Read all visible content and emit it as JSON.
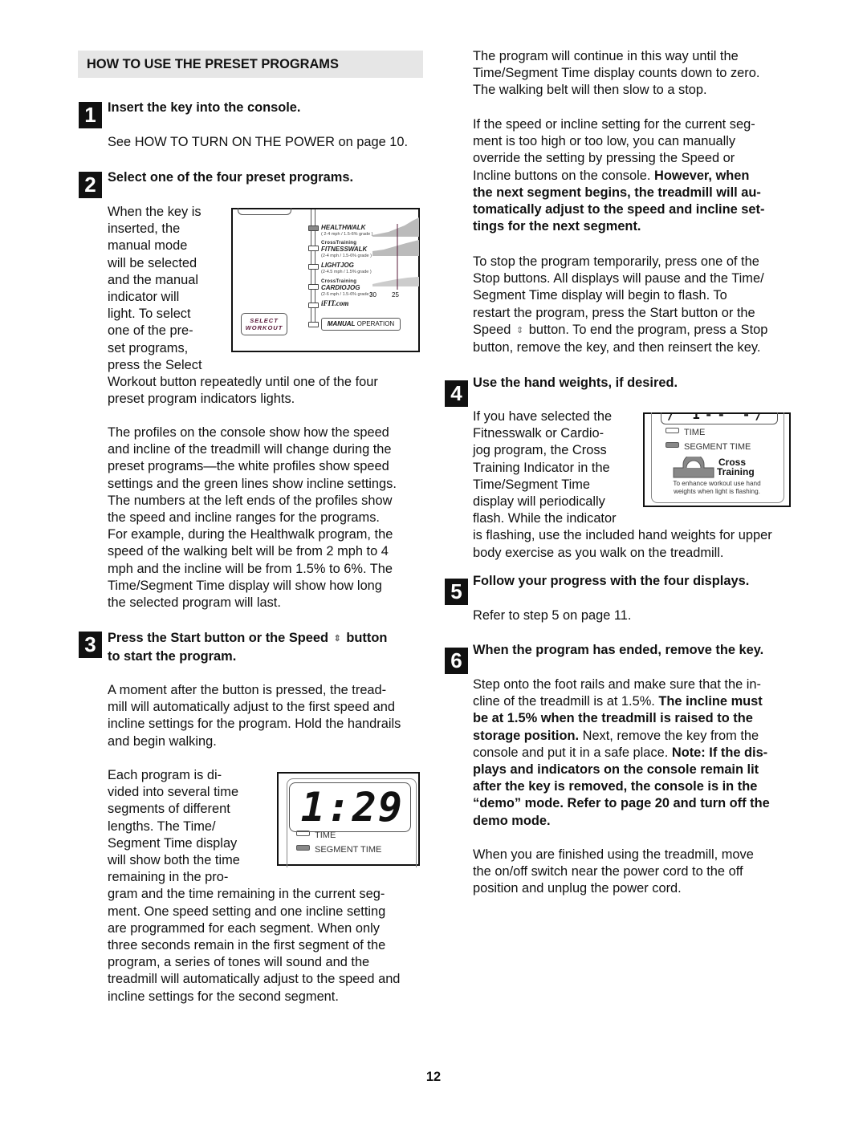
{
  "section_title": "HOW TO USE THE PRESET PROGRAMS",
  "steps": [
    {
      "number": "1",
      "title": "Insert the key into the console.",
      "body": "See HOW TO TURN ON THE POWER on page 10."
    },
    {
      "number": "2",
      "title": "Select one of the four preset programs.",
      "wrap_lines": [
        "When the key is",
        "inserted, the",
        "manual mode",
        "will be selected",
        "and the manual",
        "indicator will",
        "light. To select",
        "one of the pre-",
        "set programs,",
        "press the Select"
      ],
      "wrap_continue": [
        "Workout button repeatedly until one of the four",
        "preset program indicators lights."
      ],
      "para2": [
        "The profiles on the console show how the speed",
        "and incline of the treadmill will change during the",
        "preset programs—the white profiles show speed",
        "settings and the green lines show incline settings.",
        "The numbers at the left ends of the profiles show",
        "the speed and incline ranges for the programs.",
        "For example, during the Healthwalk program, the",
        "speed of the walking belt will be from 2 mph to 4",
        "mph and the incline will be from 1.5% to 6%. The",
        "Time/Segment Time display will show how long",
        "the selected program will last."
      ]
    },
    {
      "number": "3",
      "title_line1_a": "Press the Start button or the Speed",
      "title_line1_b": "button",
      "title_line2": "to start the program.",
      "para1": [
        "A moment after the button is pressed, the tread-",
        "mill will automatically adjust to the first speed and",
        "incline settings for the program. Hold the handrails",
        "and begin walking."
      ],
      "wrap_lines": [
        "Each program is di-",
        "vided into several time",
        "segments of different",
        "lengths. The Time/",
        "Segment Time display",
        "will show both the time",
        "remaining in the pro-"
      ],
      "wrap_continue": [
        "gram and the time remaining in the current seg-",
        "ment. One speed setting and one incline setting",
        "are programmed for each segment. When only",
        "three seconds remain in the first segment of the",
        "program, a series of tones will sound and the",
        "treadmill will automatically adjust to the speed and",
        "incline settings for the second segment."
      ]
    },
    {
      "number": "4",
      "title": "Use the hand weights, if desired.",
      "wrap_lines": [
        "If you have selected the",
        "Fitnesswalk or Cardio-",
        "jog program, the Cross",
        "Training Indicator in the",
        "Time/Segment Time",
        "display will periodically",
        "flash. While the indicator"
      ],
      "wrap_continue": [
        "is flashing, use the included hand weights for upper",
        "body exercise as you walk on the treadmill."
      ]
    },
    {
      "number": "5",
      "title": "Follow your progress with the four displays.",
      "body": "Refer to step 5 on page 11."
    },
    {
      "number": "6",
      "title": "When the program has ended, remove the key."
    }
  ],
  "right_col": {
    "para1": [
      "The program will continue in this way until the",
      "Time/Segment Time display counts down to zero.",
      "The walking belt will then slow to a stop."
    ],
    "para2_plain": [
      "If the speed or incline setting for the current seg-",
      "ment is too high or too low, you can manually",
      "override the setting by pressing the Speed or"
    ],
    "para2_mixed_a": "Incline buttons on the console. ",
    "para2_mixed_b": "However, when",
    "para2_bold": [
      "the next segment begins, the treadmill will au-",
      "tomatically adjust to the speed and incline set-",
      "tings for the next segment."
    ],
    "para3_a": [
      "To stop the program temporarily, press one of the",
      "Stop buttons. All displays will pause and the Time/",
      "Segment Time display will begin to flash. To",
      "restart the program, press the Start button or the"
    ],
    "para3_speed_a": "Speed",
    "para3_speed_b": "button. To end the program, press a Stop",
    "para3_b": "button, remove the key, and then reinsert the key.",
    "step6_lines": [
      [
        {
          "t": "Step onto the foot rails and make sure that the in-",
          "b": false
        }
      ],
      [
        {
          "t": "cline of the treadmill is at 1.5%. ",
          "b": false
        },
        {
          "t": "The incline must",
          "b": true
        }
      ],
      [
        {
          "t": "be at 1.5% when the treadmill is raised to the",
          "b": true
        }
      ],
      [
        {
          "t": "storage position.",
          "b": true
        },
        {
          "t": " Next, remove the key from the",
          "b": false
        }
      ],
      [
        {
          "t": "console and put it in a safe place. ",
          "b": false
        },
        {
          "t": "Note: If the dis-",
          "b": true
        }
      ],
      [
        {
          "t": "plays and indicators on the console remain lit",
          "b": true
        }
      ],
      [
        {
          "t": "after the key is removed, the console is in the",
          "b": true
        }
      ],
      [
        {
          "t": "“demo” mode. Refer to page 20 and turn off the",
          "b": true
        }
      ],
      [
        {
          "t": "demo mode.",
          "b": true
        }
      ]
    ],
    "final_para": [
      "When you are finished using the treadmill, move",
      "the on/off switch near the power cord to the off",
      "position and unplug the power cord."
    ]
  },
  "speed_icon": "up-down-arrow-icon",
  "console_figure": {
    "programs": [
      {
        "name": "HEALTHWALK",
        "prefix": "",
        "range": "( 2-4 mph / 1.5-6% grade )",
        "lit": true
      },
      {
        "name": "FITNESSWALK",
        "prefix": "CrossTraining",
        "range": "(2-4 mph / 1.5-6% grade )",
        "lit": false
      },
      {
        "name": "LIGHTJOG",
        "prefix": "",
        "range": "(2-4.5 mph / 1.5% grade )",
        "lit": false
      },
      {
        "name": "CARDIOJOG",
        "prefix": "CrossTraining",
        "range": "(2-6 mph / 1.5-6% grade )",
        "lit": false
      }
    ],
    "logo": "iFIT.com",
    "axis_labels": [
      "30",
      "25"
    ],
    "select_workout": [
      "SELECT",
      "WORKOUT"
    ],
    "manual_a": "MANUAL",
    "manual_b": " OPERATION"
  },
  "time_display": {
    "value": "1:29",
    "time_label": "TIME",
    "segment_label": "SEGMENT TIME"
  },
  "cross_display": {
    "time_label": "TIME",
    "segment_label": "SEGMENT TIME",
    "cross1": "Cross",
    "cross2": "Training",
    "note1": "To enhance workout use hand",
    "note2": "weights when light is flashing."
  },
  "page_number": "12"
}
